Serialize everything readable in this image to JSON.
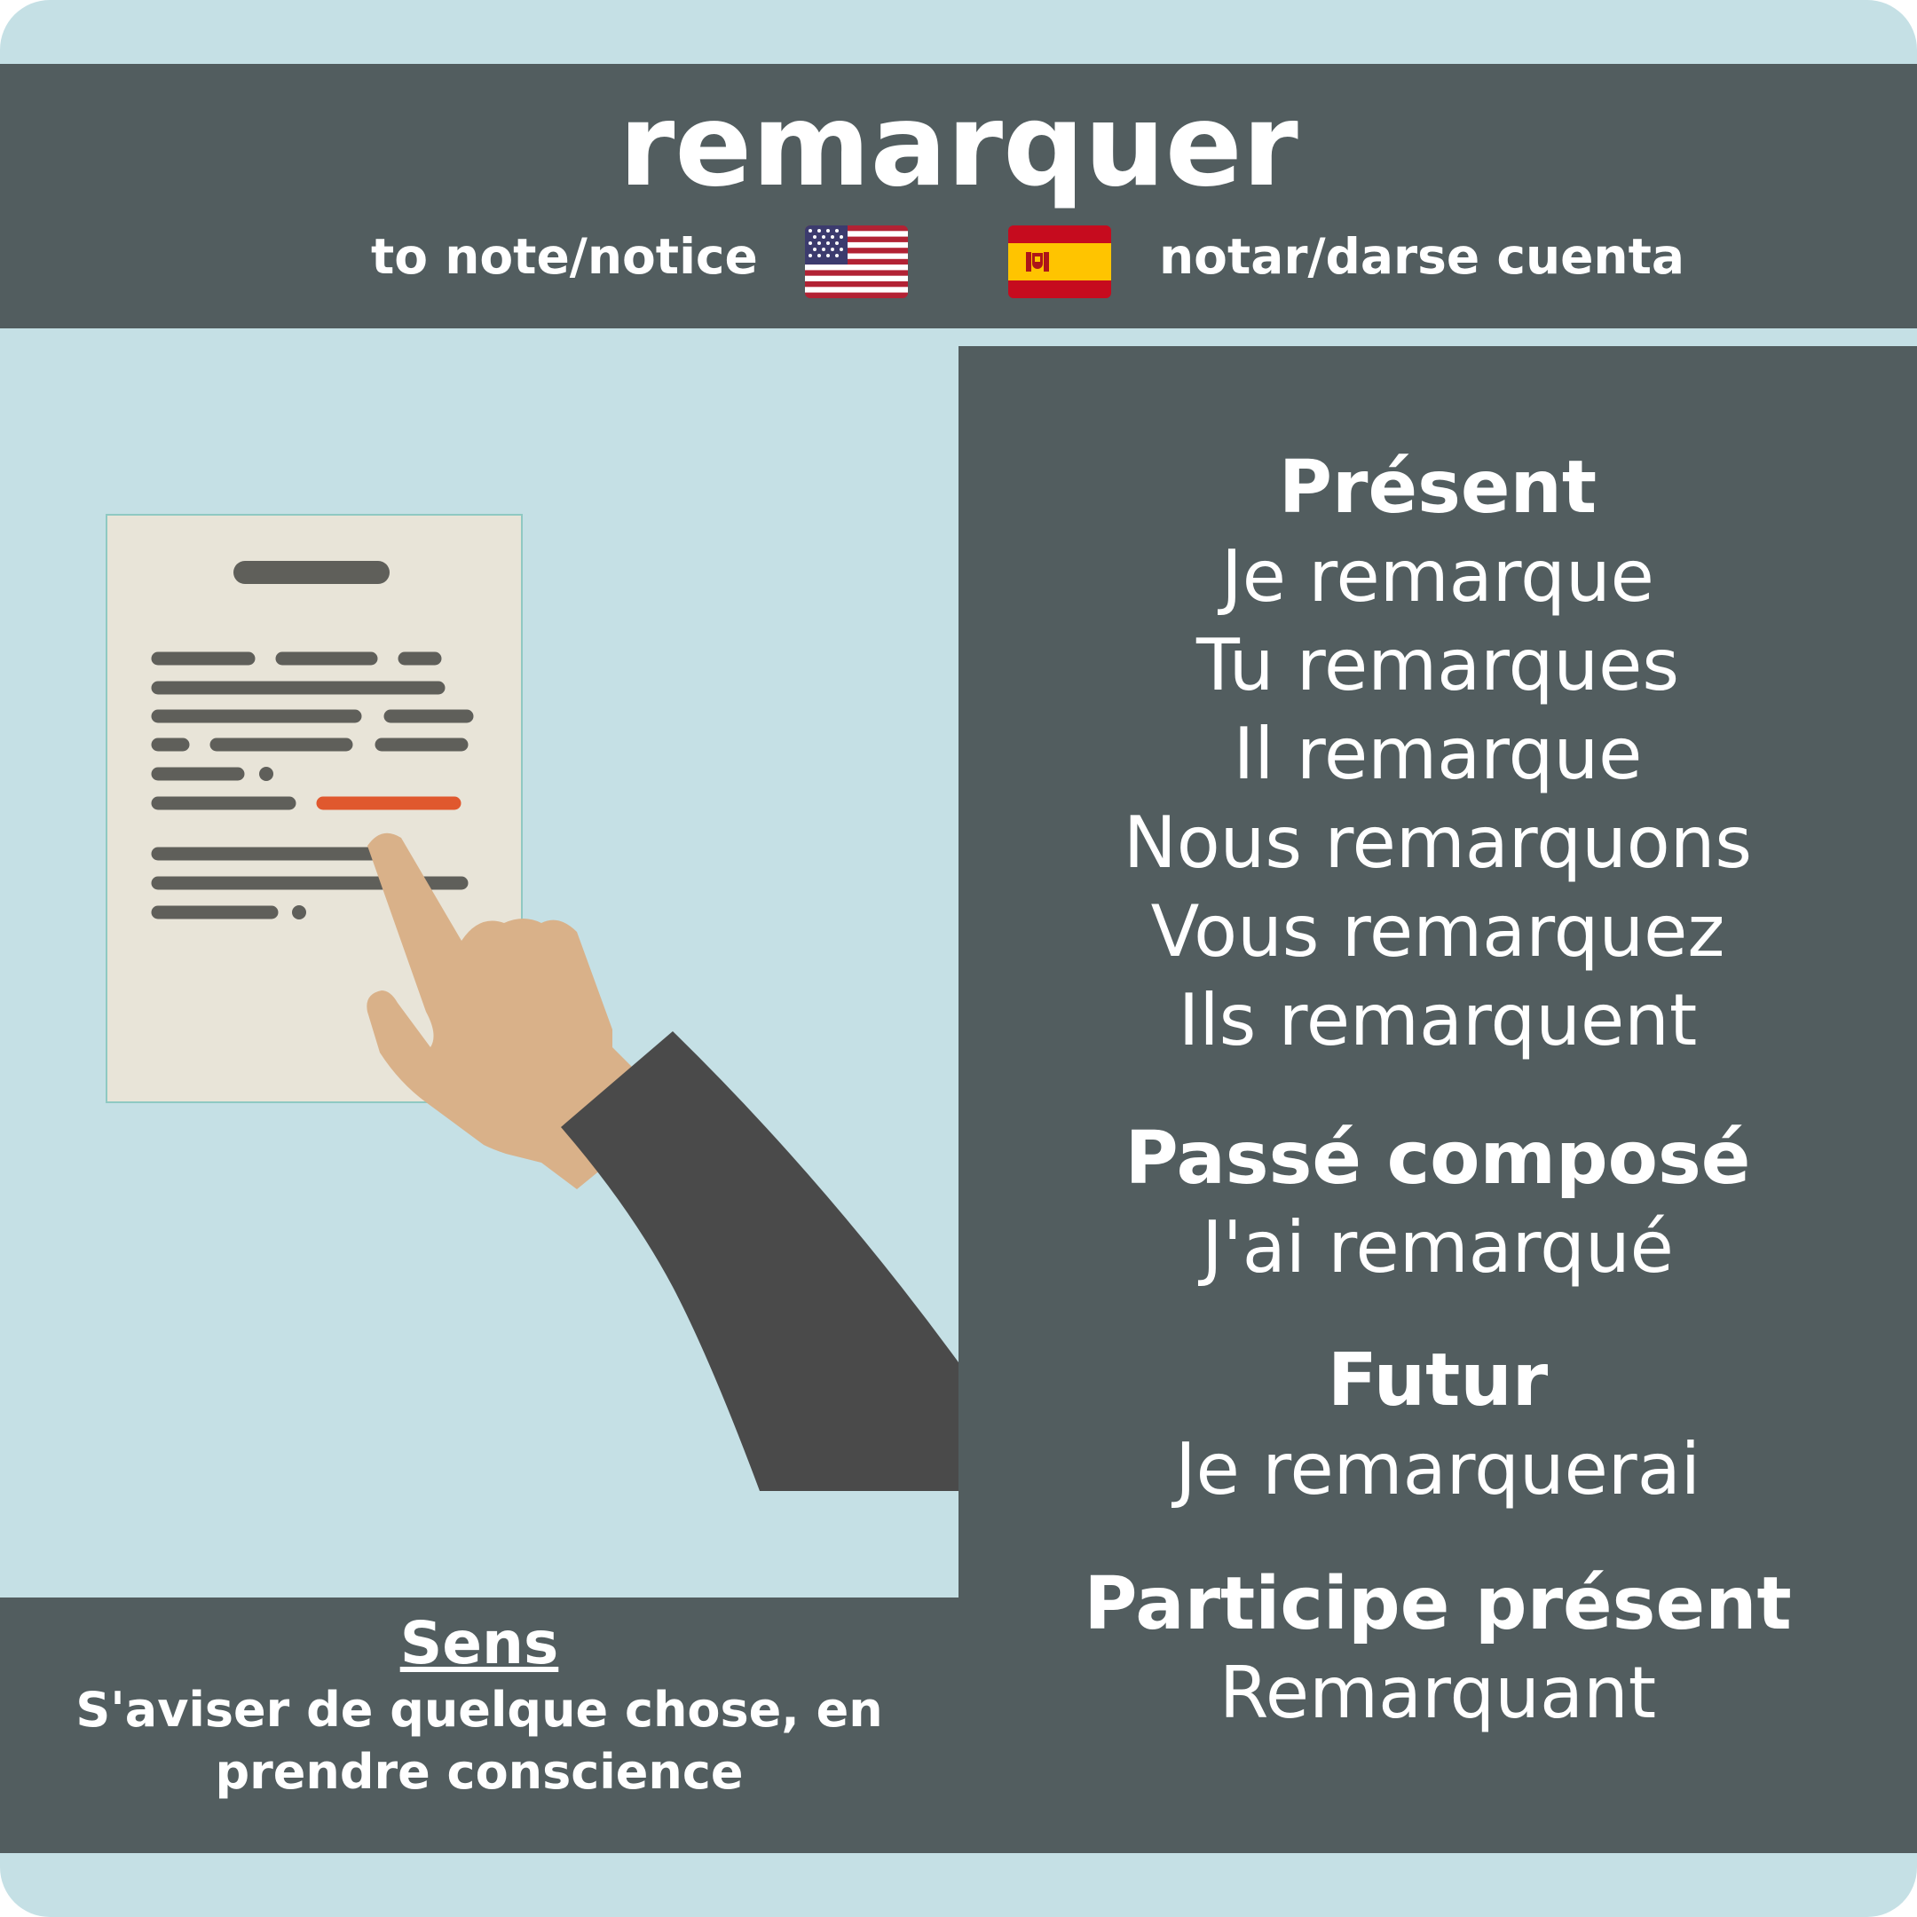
{
  "verb": "remarquer",
  "translations": {
    "english": "to note/notice",
    "spanish": "notar/darse cuenta"
  },
  "flags": {
    "english": "us-flag-icon",
    "spanish": "spain-flag-icon"
  },
  "conjugations": {
    "present": {
      "heading": "Présent",
      "forms": [
        "Je remarque",
        "Tu remarques",
        "Il remarque",
        "Nous remarquons",
        "Vous remarquez",
        "Ils remarquent"
      ]
    },
    "passe_compose": {
      "heading": "Passé composé",
      "form": "J'ai remarqué"
    },
    "futur": {
      "heading": "Futur",
      "form": "Je remarquerai"
    },
    "participe_present": {
      "heading": "Participe présent",
      "form": "Remarquant"
    }
  },
  "meaning": {
    "title": "Sens",
    "text": "S'aviser de quelque chose, en prendre conscience"
  },
  "colors": {
    "background": "#c5e0e5",
    "panel": "#525d5f",
    "text": "#ffffff",
    "paper": "#e8e4d8",
    "paper_lines": "#5f5f5a",
    "highlight": "#e0582e",
    "skin": "#d9b189",
    "sleeve": "#4a4a4a"
  }
}
